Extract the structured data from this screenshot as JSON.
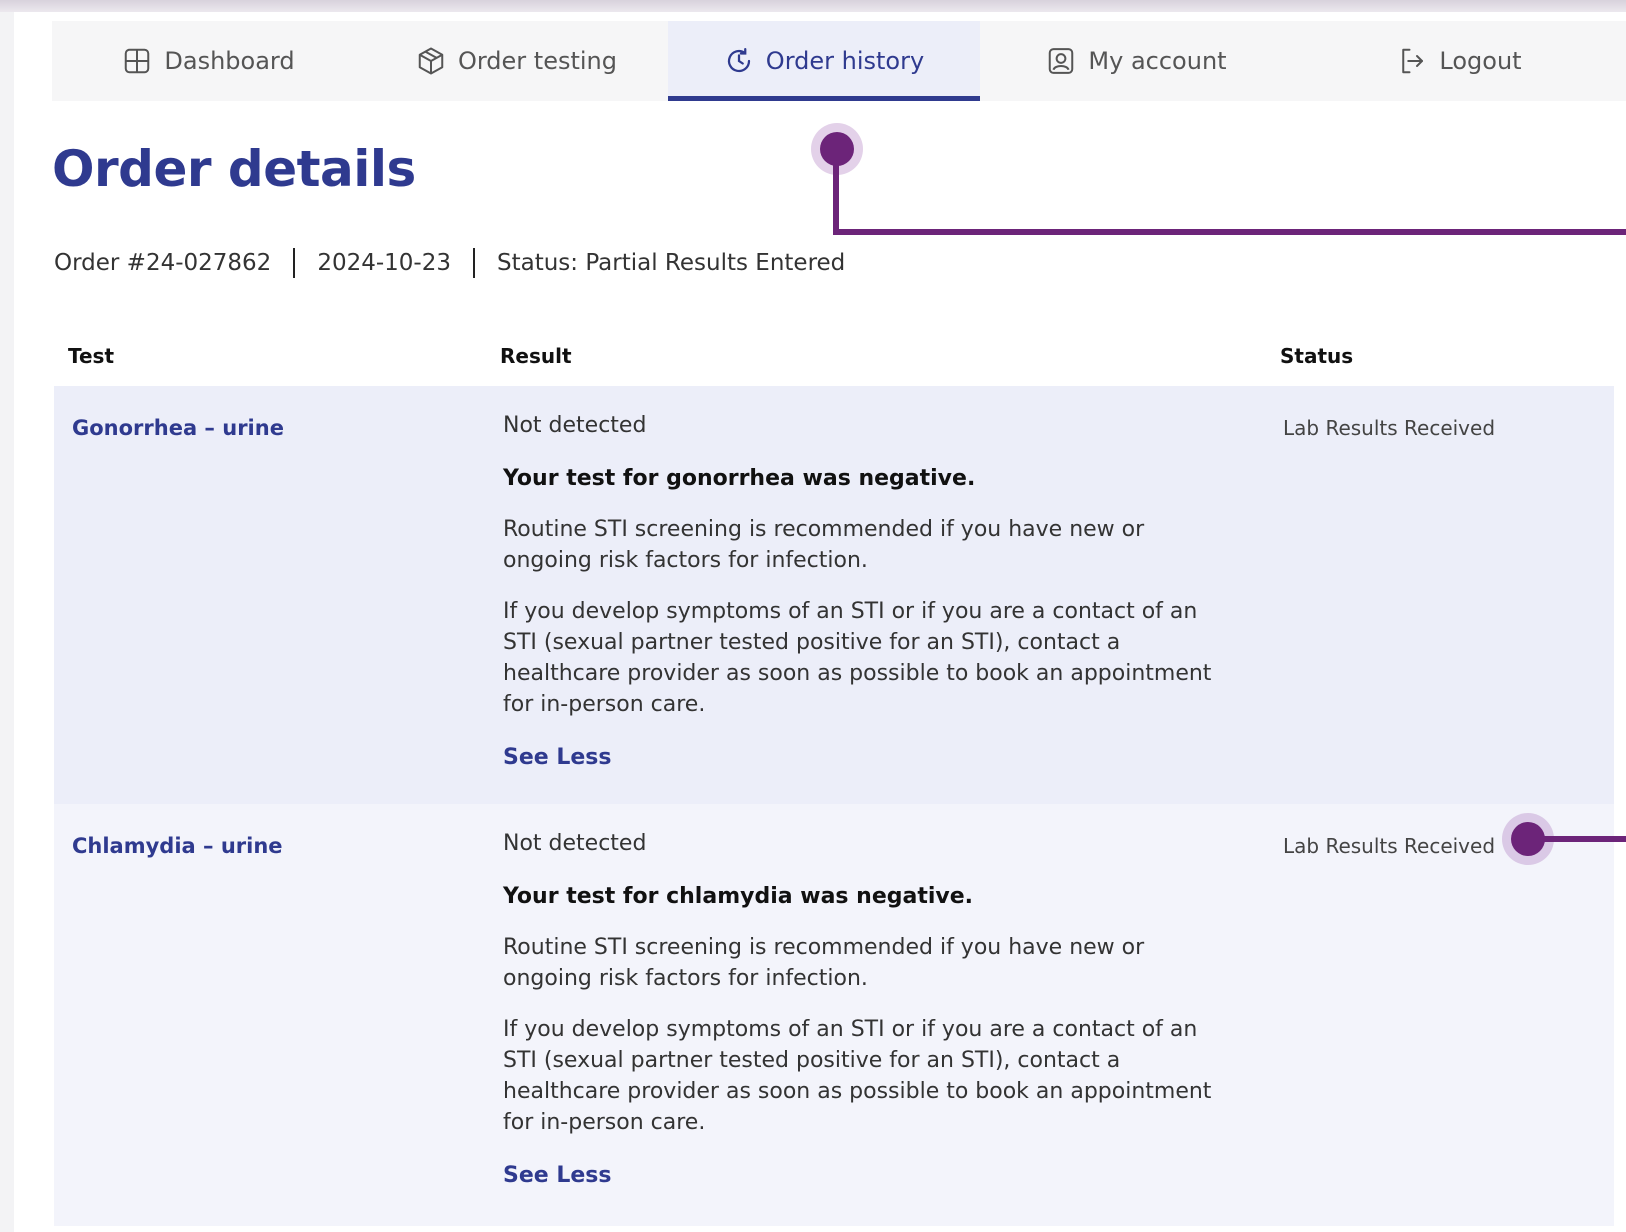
{
  "nav": {
    "items": [
      {
        "label": "Dashboard",
        "icon": "grid-icon",
        "active": false
      },
      {
        "label": "Order testing",
        "icon": "package-icon",
        "active": false
      },
      {
        "label": "Order history",
        "icon": "history-icon",
        "active": true
      },
      {
        "label": "My account",
        "icon": "user-icon",
        "active": false
      },
      {
        "label": "Logout",
        "icon": "logout-icon",
        "active": false
      }
    ]
  },
  "page": {
    "title": "Order details",
    "order_number": "Order #24-027862",
    "date": "2024-10-23",
    "status": "Status: Partial Results Entered"
  },
  "table": {
    "headers": {
      "test": "Test",
      "result": "Result",
      "status": "Status"
    },
    "rows": [
      {
        "test": "Gonorrhea – urine",
        "result": "Not detected",
        "headline": "Your test for gonorrhea was negative.",
        "para1": "Routine STI screening is recommended if you have new or ongoing risk factors for infection.",
        "para2": "If you develop symptoms of an STI or if you are a contact of an STI (sexual partner tested positive for an STI), contact a healthcare provider as soon as possible to book an appointment for in-person care.",
        "toggle": "See Less",
        "status": "Lab Results Received"
      },
      {
        "test": "Chlamydia – urine",
        "result": "Not detected",
        "headline": "Your test for chlamydia was negative.",
        "para1": "Routine STI screening is recommended if you have new or ongoing risk factors for infection.",
        "para2": "If you develop symptoms of an STI or if you are a contact of an STI (sexual partner tested positive for an STI), contact a healthcare provider as soon as possible to book an appointment for in-person care.",
        "toggle": "See Less",
        "status": "Lab Results Received"
      }
    ]
  },
  "colors": {
    "brand": "#2f3a8f",
    "annotation": "#6c2479",
    "row_bg_1": "#eceef9",
    "row_bg_2": "#f3f4fb"
  }
}
